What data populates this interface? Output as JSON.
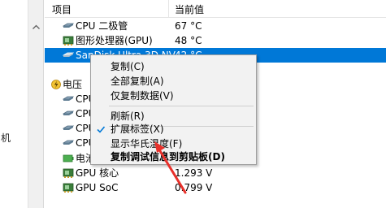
{
  "left_pane": {
    "chars": [
      "机"
    ]
  },
  "header": {
    "col_item": "项目",
    "col_value": "当前值"
  },
  "rows": [
    {
      "label": "CPU 二极管",
      "value": "67 °C",
      "icon": "sensor-icon"
    },
    {
      "label": "图形处理器(GPU)",
      "value": "48 °C",
      "icon": "gpu-icon"
    },
    {
      "label": "SanDisk Ultra 3D NV",
      "value": "42 °C",
      "icon": "drive-icon"
    },
    {
      "label": "电压",
      "value": "",
      "icon": "voltage-icon"
    },
    {
      "label": "CPU",
      "value": "",
      "icon": "sensor-icon"
    },
    {
      "label": "CPU",
      "value": "",
      "icon": "sensor-icon"
    },
    {
      "label": "CPU",
      "value": "",
      "icon": "sensor-icon"
    },
    {
      "label": "CPU",
      "value": "",
      "icon": "sensor-icon"
    },
    {
      "label": "电池",
      "value": "",
      "icon": "battery-icon"
    },
    {
      "label": "GPU 核心",
      "value": "1.293 V",
      "icon": "gpu-icon"
    },
    {
      "label": "GPU SoC",
      "value": "0.799 V",
      "icon": "gpu-icon"
    }
  ],
  "context_menu": {
    "copy": "复制(C)",
    "copy_all": "全部复制(A)",
    "copy_data_only": "仅复制数据(V)",
    "refresh": "刷新(R)",
    "expand_labels": "扩展标签(X)",
    "show_fahrenheit": "显示华氏温度(F)",
    "copy_debug": "复制调试信息到剪贴板(D)"
  },
  "colors": {
    "selection": "#0078d7",
    "annotation_arrow": "#e8302a",
    "menu_bg": "#f2f2f2"
  }
}
